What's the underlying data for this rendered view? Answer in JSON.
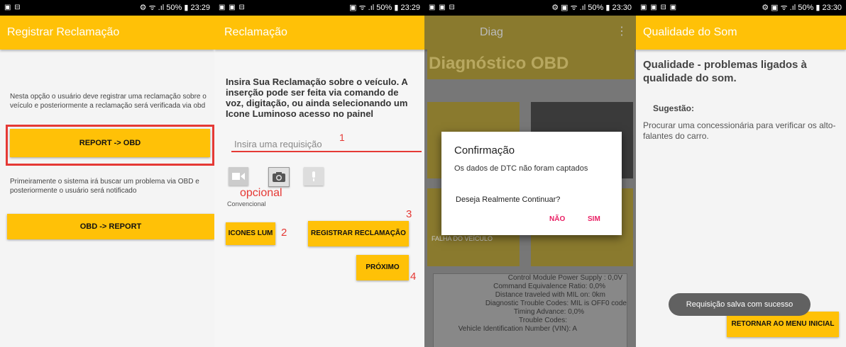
{
  "screen1": {
    "status_left": "▣ ⊟",
    "status_right": "⚙ ᯤ .ıl 50% ▮ 23:29",
    "title": "Registrar Reclamação",
    "desc1": "Nesta opção o usuário deve registrar uma reclamação sobre o veículo e posteriormente a reclamação será verificada via obd",
    "btn1": "REPORT -> OBD",
    "desc2": "Primeiramente o sistema irá buscar um problema via OBD e posteriormente o usuário será notificado",
    "btn2": "OBD -> REPORT"
  },
  "screen2": {
    "status_left": "▣ ▣ ⊟",
    "status_right": "▣ ᯤ .ıl 50% ▮ 23:29",
    "title": "Reclamação",
    "instructions": "Insira Sua Reclamação sobre o veículo. A inserção pode ser feita via comando de voz, digitação, ou ainda selecionando um Icone Luminoso acesso no painel",
    "input_placeholder": "Insira uma requisição",
    "mark1": "1",
    "optional": "opcional",
    "conventional": "Convencional",
    "btn_icones": "ICONES LUM",
    "mark2": "2",
    "btn_registrar": "REGISTRAR RECLAMAÇÃO",
    "mark3": "3",
    "btn_proximo": "PRÓXIMO",
    "mark4": "4"
  },
  "screen3": {
    "status_left": "▣ ▣ ⊟",
    "status_right": "⚙ ▣ ᯤ .ıl 50% ▮ 23:30",
    "title": "Diag",
    "menu": "⋮",
    "heading": "Diagnóstico OBD",
    "tile_label": "FALHA DO VEÍCULO",
    "dialog_title": "Confirmação",
    "dialog_msg": "Os dados de DTC não foram captados",
    "dialog_question": "Deseja Realmente Continuar?",
    "dialog_no": "NÃO",
    "dialog_yes": "SIM",
    "data_lines": [
      "Control Module Power Supply : 0,0V",
      "Command Equivalence Ratio: 0,0%",
      "Distance traveled with MIL on: 0km",
      "Diagnostic Trouble Codes: MIL is OFF0 code",
      "Timing Advance: 0,0%",
      "Trouble Codes:",
      "Vehicle Identification Number (VIN): A"
    ]
  },
  "screen4": {
    "status_left": "▣ ▣ ⊟ ▣",
    "status_right": "⚙ ▣ ᯤ .ıl 50% ▮ 23:30",
    "title": "Qualidade do Som",
    "heading": "Qualidade - problemas ligados à qualidade do som.",
    "suggestion_label": "Sugestão:",
    "suggestion_text": "Procurar uma concessionária para verificar os alto-falantes do carro.",
    "toast": "Requisição salva com sucesso",
    "btn_return": "RETORNAR AO MENU INICIAL"
  },
  "colors": {
    "accent": "#FFC107",
    "highlight": "#e53935",
    "dialog_action": "#E91E63"
  }
}
